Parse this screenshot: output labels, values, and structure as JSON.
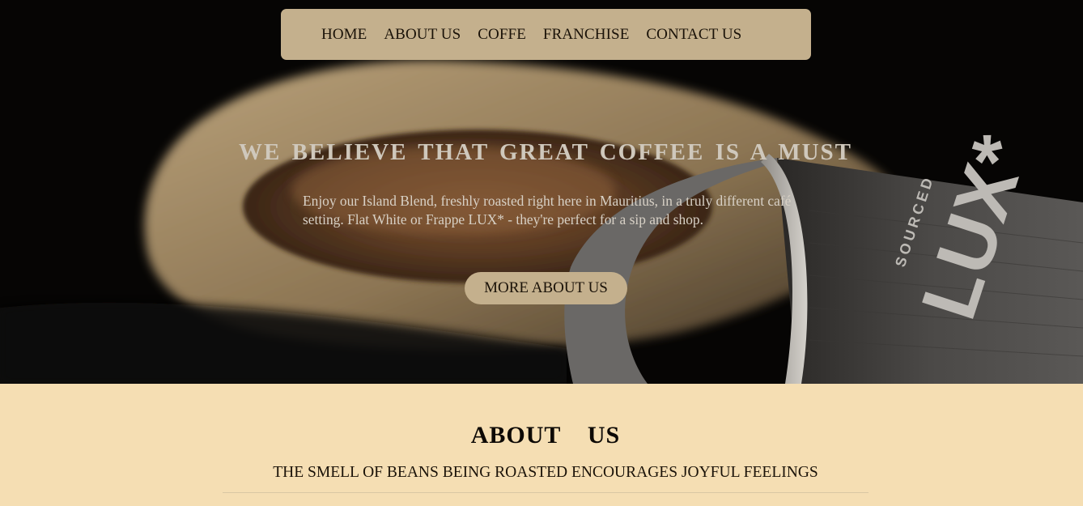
{
  "nav": {
    "items": [
      {
        "label": "HOME"
      },
      {
        "label": "ABOUT US"
      },
      {
        "label": "COFFE"
      },
      {
        "label": "FRANCHISE"
      },
      {
        "label": "CONTACT US"
      }
    ]
  },
  "hero": {
    "title": "WE BELIEVE THAT GREAT COFFEE IS A MUST",
    "text": "Enjoy our Island Blend, freshly roasted right here in Mauritius, in a truly different café setting. Flat White or Frappe LUX* - they're perfect for a sip and shop.",
    "button_label": "MORE ABOUT US",
    "cup_logo": "LUX*",
    "cup_tagline": "SOURCED"
  },
  "about": {
    "title": "ABOUT  US",
    "subtitle": "THE SMELL OF BEANS BEING ROASTED ENCOURAGES JOYFUL FEELINGS"
  },
  "colors": {
    "accent": "#c4b08d",
    "section_bg": "#f5deb3",
    "hero_bg": "#050403"
  }
}
